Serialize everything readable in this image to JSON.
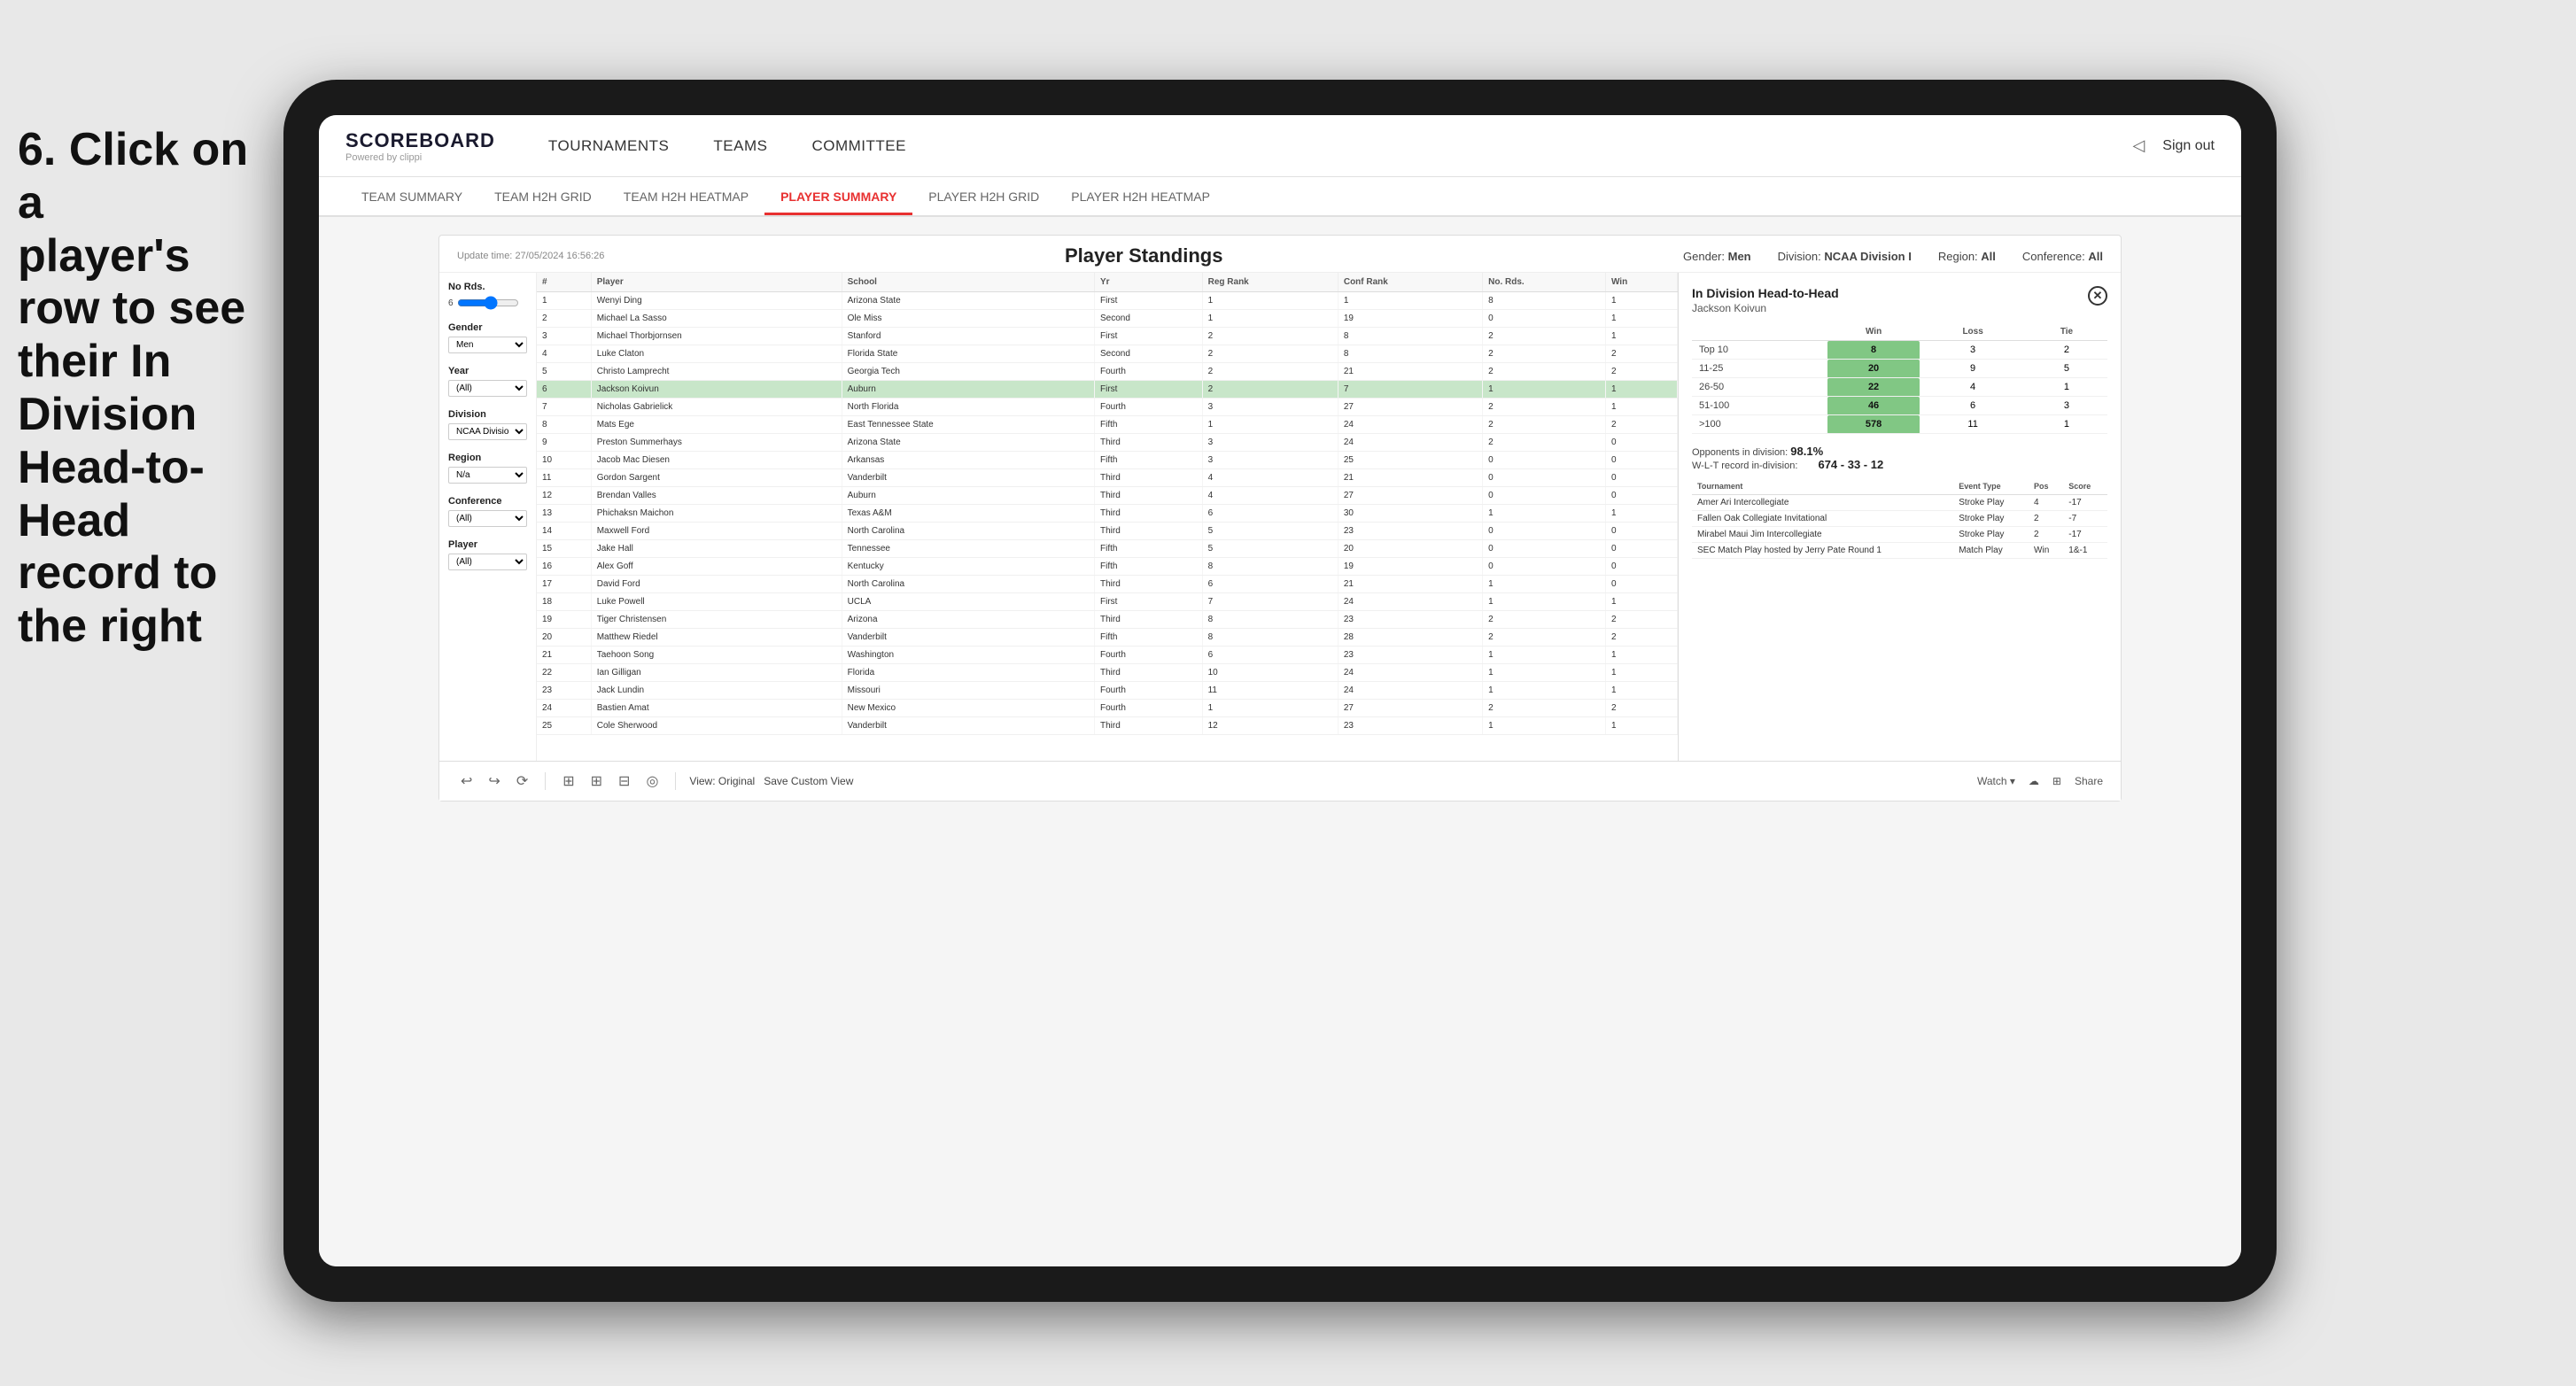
{
  "instruction": {
    "line1": "6. Click on a",
    "line2": "player's row to see",
    "line3": "their In Division",
    "line4": "Head-to-Head",
    "line5": "record to the right"
  },
  "brand": {
    "title": "SCOREBOARD",
    "subtitle": "Powered by clippi"
  },
  "topnav": {
    "items": [
      "TOURNAMENTS",
      "TEAMS",
      "COMMITTEE"
    ],
    "sign_out": "Sign out"
  },
  "subnav": {
    "items": [
      "TEAM SUMMARY",
      "TEAM H2H GRID",
      "TEAM H2H HEATMAP",
      "PLAYER SUMMARY",
      "PLAYER H2H GRID",
      "PLAYER H2H HEATMAP"
    ]
  },
  "dashboard": {
    "update_time_label": "Update time:",
    "update_time": "27/05/2024 16:56:26",
    "title": "Player Standings",
    "filters": {
      "gender_label": "Gender:",
      "gender_value": "Men",
      "division_label": "Division:",
      "division_value": "NCAA Division I",
      "region_label": "Region:",
      "region_value": "All",
      "conference_label": "Conference:",
      "conference_value": "All"
    }
  },
  "sidebar": {
    "rounds_label": "No Rds.",
    "rounds_value": "6",
    "gender_label": "Gender",
    "gender_value": "Men",
    "year_label": "Year",
    "year_value": "(All)",
    "division_label": "Division",
    "division_value": "NCAA Division I",
    "region_label": "Region",
    "region_value": "N/a",
    "conference_label": "Conference",
    "conference_value": "(All)",
    "player_label": "Player",
    "player_value": "(All)"
  },
  "table": {
    "columns": [
      "#",
      "Player",
      "School",
      "Yr",
      "Reg Rank",
      "Conf Rank",
      "No. Rds.",
      "Win"
    ],
    "rows": [
      {
        "num": "1",
        "id": "1",
        "player": "Wenyi Ding",
        "school": "Arizona State",
        "yr": "First",
        "reg_rank": "1",
        "conf_rank": "1",
        "no_rds": "8",
        "win": "1"
      },
      {
        "num": "2",
        "id": "2",
        "player": "Michael La Sasso",
        "school": "Ole Miss",
        "yr": "Second",
        "reg_rank": "1",
        "conf_rank": "19",
        "no_rds": "0",
        "win": "1"
      },
      {
        "num": "3",
        "id": "3",
        "player": "Michael Thorbjornsen",
        "school": "Stanford",
        "yr": "First",
        "reg_rank": "2",
        "conf_rank": "8",
        "no_rds": "2",
        "win": "1"
      },
      {
        "num": "4",
        "id": "4",
        "player": "Luke Claton",
        "school": "Florida State",
        "yr": "Second",
        "reg_rank": "2",
        "conf_rank": "8",
        "no_rds": "2",
        "win": "2"
      },
      {
        "num": "5",
        "id": "5",
        "player": "Christo Lamprecht",
        "school": "Georgia Tech",
        "yr": "Fourth",
        "reg_rank": "2",
        "conf_rank": "21",
        "no_rds": "2",
        "win": "2"
      },
      {
        "num": "6",
        "id": "6",
        "player": "Jackson Koivun",
        "school": "Auburn",
        "yr": "First",
        "reg_rank": "2",
        "conf_rank": "7",
        "no_rds": "1",
        "win": "1",
        "selected": true
      },
      {
        "num": "7",
        "id": "7",
        "player": "Nicholas Gabrielick",
        "school": "North Florida",
        "yr": "Fourth",
        "reg_rank": "3",
        "conf_rank": "27",
        "no_rds": "2",
        "win": "1"
      },
      {
        "num": "8",
        "id": "8",
        "player": "Mats Ege",
        "school": "East Tennessee State",
        "yr": "Fifth",
        "reg_rank": "1",
        "conf_rank": "24",
        "no_rds": "2",
        "win": "2"
      },
      {
        "num": "9",
        "id": "9",
        "player": "Preston Summerhays",
        "school": "Arizona State",
        "yr": "Third",
        "reg_rank": "3",
        "conf_rank": "24",
        "no_rds": "2",
        "win": "0"
      },
      {
        "num": "10",
        "id": "10",
        "player": "Jacob Mac Diesen",
        "school": "Arkansas",
        "yr": "Fifth",
        "reg_rank": "3",
        "conf_rank": "25",
        "no_rds": "0",
        "win": "0"
      },
      {
        "num": "11",
        "id": "11",
        "player": "Gordon Sargent",
        "school": "Vanderbilt",
        "yr": "Third",
        "reg_rank": "4",
        "conf_rank": "21",
        "no_rds": "0",
        "win": "0"
      },
      {
        "num": "12",
        "id": "12",
        "player": "Brendan Valles",
        "school": "Auburn",
        "yr": "Third",
        "reg_rank": "4",
        "conf_rank": "27",
        "no_rds": "0",
        "win": "0"
      },
      {
        "num": "13",
        "id": "13",
        "player": "Phichaksn Maichon",
        "school": "Texas A&M",
        "yr": "Third",
        "reg_rank": "6",
        "conf_rank": "30",
        "no_rds": "1",
        "win": "1"
      },
      {
        "num": "14",
        "id": "14",
        "player": "Maxwell Ford",
        "school": "North Carolina",
        "yr": "Third",
        "reg_rank": "5",
        "conf_rank": "23",
        "no_rds": "0",
        "win": "0"
      },
      {
        "num": "15",
        "id": "15",
        "player": "Jake Hall",
        "school": "Tennessee",
        "yr": "Fifth",
        "reg_rank": "5",
        "conf_rank": "20",
        "no_rds": "0",
        "win": "0"
      },
      {
        "num": "16",
        "id": "16",
        "player": "Alex Goff",
        "school": "Kentucky",
        "yr": "Fifth",
        "reg_rank": "8",
        "conf_rank": "19",
        "no_rds": "0",
        "win": "0"
      },
      {
        "num": "17",
        "id": "17",
        "player": "David Ford",
        "school": "North Carolina",
        "yr": "Third",
        "reg_rank": "6",
        "conf_rank": "21",
        "no_rds": "1",
        "win": "0"
      },
      {
        "num": "18",
        "id": "18",
        "player": "Luke Powell",
        "school": "UCLA",
        "yr": "First",
        "reg_rank": "7",
        "conf_rank": "24",
        "no_rds": "1",
        "win": "1"
      },
      {
        "num": "19",
        "id": "19",
        "player": "Tiger Christensen",
        "school": "Arizona",
        "yr": "Third",
        "reg_rank": "8",
        "conf_rank": "23",
        "no_rds": "2",
        "win": "2"
      },
      {
        "num": "20",
        "id": "20",
        "player": "Matthew Riedel",
        "school": "Vanderbilt",
        "yr": "Fifth",
        "reg_rank": "8",
        "conf_rank": "28",
        "no_rds": "2",
        "win": "2"
      },
      {
        "num": "21",
        "id": "21",
        "player": "Taehoon Song",
        "school": "Washington",
        "yr": "Fourth",
        "reg_rank": "6",
        "conf_rank": "23",
        "no_rds": "1",
        "win": "1"
      },
      {
        "num": "22",
        "id": "22",
        "player": "Ian Gilligan",
        "school": "Florida",
        "yr": "Third",
        "reg_rank": "10",
        "conf_rank": "24",
        "no_rds": "1",
        "win": "1"
      },
      {
        "num": "23",
        "id": "23",
        "player": "Jack Lundin",
        "school": "Missouri",
        "yr": "Fourth",
        "reg_rank": "11",
        "conf_rank": "24",
        "no_rds": "1",
        "win": "1"
      },
      {
        "num": "24",
        "id": "24",
        "player": "Bastien Amat",
        "school": "New Mexico",
        "yr": "Fourth",
        "reg_rank": "1",
        "conf_rank": "27",
        "no_rds": "2",
        "win": "2"
      },
      {
        "num": "25",
        "id": "25",
        "player": "Cole Sherwood",
        "school": "Vanderbilt",
        "yr": "Third",
        "reg_rank": "12",
        "conf_rank": "23",
        "no_rds": "1",
        "win": "1"
      }
    ]
  },
  "h2h_panel": {
    "title": "In Division Head-to-Head",
    "player_name": "Jackson Koivun",
    "headers": [
      "Win",
      "Loss",
      "Tie"
    ],
    "ranks": [
      {
        "range": "Top 10",
        "win": "8",
        "loss": "3",
        "tie": "2"
      },
      {
        "range": "11-25",
        "win": "20",
        "loss": "9",
        "tie": "5"
      },
      {
        "range": "26-50",
        "win": "22",
        "loss": "4",
        "tie": "1"
      },
      {
        "range": "51-100",
        "win": "46",
        "loss": "6",
        "tie": "3"
      },
      {
        "range": ">100",
        "win": "578",
        "loss": "11",
        "tie": "1"
      }
    ],
    "opponents_label": "Opponents in division:",
    "opponents_pct": "98.1%",
    "wlt_label": "W-L-T record in-division:",
    "wlt_value": "674 - 33 - 12",
    "tourney_headers": [
      "Tournament",
      "Event Type",
      "Pos",
      "Score"
    ],
    "tournaments": [
      {
        "name": "Amer Ari Intercollegiate",
        "type": "Stroke Play",
        "pos": "4",
        "score": "-17"
      },
      {
        "name": "Fallen Oak Collegiate Invitational",
        "type": "Stroke Play",
        "pos": "2",
        "score": "-7"
      },
      {
        "name": "Mirabel Maui Jim Intercollegiate",
        "type": "Stroke Play",
        "pos": "2",
        "score": "-17"
      },
      {
        "name": "SEC Match Play hosted by Jerry Pate Round 1",
        "type": "Match Play",
        "pos": "Win",
        "score": "1&-1"
      }
    ]
  },
  "toolbar": {
    "buttons": [
      "↩",
      "↪",
      "⟳",
      "⊞",
      "⊞",
      "⊟",
      "◎"
    ],
    "view_original": "View: Original",
    "save_custom": "Save Custom View",
    "watch": "Watch ▾",
    "share": "Share"
  }
}
